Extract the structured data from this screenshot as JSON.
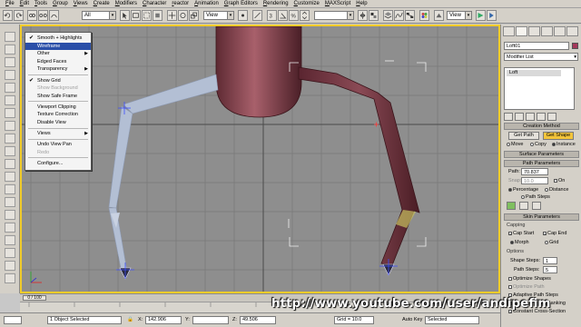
{
  "menubar": [
    "File",
    "Edit",
    "Tools",
    "Group",
    "Views",
    "Create",
    "Modifiers",
    "Character",
    "reactor",
    "Animation",
    "Graph Editors",
    "Rendering",
    "Customize",
    "MAXScript",
    "Help"
  ],
  "toolbar": {
    "selection_filter": "All",
    "reference_coord": "View",
    "named_selection": ""
  },
  "viewport": {
    "label": "",
    "border_color": "#f2cc2a",
    "background": "#8e8e8e"
  },
  "context_menu": {
    "items": [
      {
        "label": "Smooth + Highlights",
        "checked": true,
        "sub": false,
        "disabled": false,
        "highlighted": false
      },
      {
        "label": "Wireframe",
        "checked": false,
        "sub": false,
        "disabled": false,
        "highlighted": true
      },
      {
        "label": "Other",
        "checked": false,
        "sub": true,
        "disabled": false,
        "highlighted": false
      },
      {
        "label": "Edged Faces",
        "checked": false,
        "sub": false,
        "disabled": false,
        "highlighted": false
      },
      {
        "label": "Transparency",
        "checked": false,
        "sub": true,
        "disabled": false,
        "highlighted": false
      },
      {
        "label": "Show Grid",
        "checked": true,
        "sub": false,
        "disabled": false,
        "highlighted": false
      },
      {
        "label": "Show Background",
        "checked": false,
        "sub": false,
        "disabled": true,
        "highlighted": false
      },
      {
        "label": "Show Safe Frame",
        "checked": false,
        "sub": false,
        "disabled": false,
        "highlighted": false
      },
      {
        "label": "Viewport Clipping",
        "checked": false,
        "sub": false,
        "disabled": false,
        "highlighted": false
      },
      {
        "label": "Texture Correction",
        "checked": false,
        "sub": false,
        "disabled": false,
        "highlighted": false
      },
      {
        "label": "Disable View",
        "checked": false,
        "sub": false,
        "disabled": false,
        "highlighted": false
      },
      {
        "label": "Views",
        "checked": false,
        "sub": true,
        "disabled": false,
        "highlighted": false
      },
      {
        "label": "Undo View Pan",
        "checked": false,
        "sub": false,
        "disabled": false,
        "highlighted": false
      },
      {
        "label": "Redo",
        "checked": false,
        "sub": false,
        "disabled": true,
        "highlighted": false
      },
      {
        "label": "Configure...",
        "checked": false,
        "sub": false,
        "disabled": false,
        "highlighted": false
      }
    ],
    "highlight_color": "#2a4fa8"
  },
  "command_panel": {
    "object_name": "Loft01",
    "modifier_list": "Modifier List",
    "stack_entry": "Loft",
    "creation_method_title": "Creation Method",
    "get_path": "Get Path",
    "get_shape": "Get Shape",
    "move": "Move",
    "copy": "Copy",
    "instance": "Instance",
    "surface_params_title": "Surface Parameters",
    "path_params_title": "Path Parameters",
    "path_label": "Path:",
    "path_value": "70.837",
    "snap_label": "Snap:",
    "snap_value": "10.0",
    "on_label": "On",
    "percentage": "Percentage",
    "distance": "Distance",
    "path_steps": "Path Steps",
    "skin_params_title": "Skin Parameters",
    "capping": "Capping",
    "cap_start": "Cap Start",
    "cap_end": "Cap End",
    "morph": "Morph",
    "grid": "Grid",
    "options": "Options",
    "shape_steps_label": "Shape Steps:",
    "shape_steps": "1",
    "path_steps_label": "Path Steps:",
    "path_steps_value": "5",
    "optimize_shapes": "Optimize Shapes",
    "optimize_path": "Optimize Path",
    "adaptive_path_steps": "Adaptive Path Steps",
    "contour": "Contour",
    "banking": "Banking",
    "constant_cross_section": "Constant Cross-Section",
    "accent": "#f3c43a"
  },
  "timeslider": {
    "label": "0 / 100"
  },
  "status": {
    "selection": "1 Object Selected",
    "x_label": "X:",
    "x_value": "142.906",
    "y_label": "Y:",
    "y_value": "",
    "z_label": "Z:",
    "z_value": "49.506",
    "grid": "Grid = 10.0",
    "auto_key": "Auto Key",
    "selected": "Selected"
  },
  "watermark": "http://www.youtube.com/user/andipefim"
}
